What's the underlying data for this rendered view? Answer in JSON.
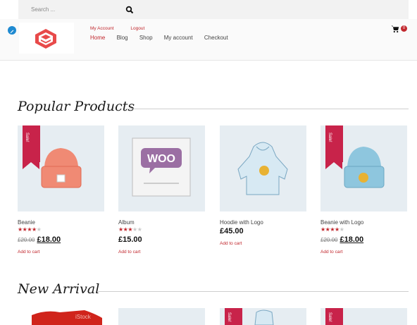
{
  "search": {
    "placeholder": "Search ..."
  },
  "header": {
    "account_links": [
      "My Account",
      "Logout"
    ],
    "nav": [
      "Home",
      "Blog",
      "Shop",
      "My account",
      "Checkout"
    ],
    "cart_count": "0"
  },
  "sections": {
    "popular": "Popular Products",
    "new_arrival": "New Arrival"
  },
  "products": [
    {
      "name": "Beanie",
      "rating": 4,
      "old_price": "£20.00",
      "price": "£18.00",
      "sale": "Sale!",
      "add_to_cart": "Add to cart",
      "color": "#f08a74"
    },
    {
      "name": "Album",
      "rating": 3,
      "old_price": "",
      "price": "£15.00",
      "sale": "",
      "add_to_cart": "Add to cart",
      "color": "#9b6fa3"
    },
    {
      "name": "Hoodie with Logo",
      "rating": 0,
      "old_price": "",
      "price": "£45.00",
      "sale": "",
      "add_to_cart": "Add to cart",
      "color": "#a9cfe6"
    },
    {
      "name": "Beanie with Logo",
      "rating": 4,
      "old_price": "£20.00",
      "price": "£18.00",
      "sale": "Sale!",
      "add_to_cart": "Add to cart",
      "color": "#8ec6de"
    }
  ],
  "new_arrival_preview": [
    {
      "label": "iStock",
      "sale": ""
    },
    {
      "label": "",
      "sale": ""
    },
    {
      "label": "",
      "sale": "Sale!"
    },
    {
      "label": "",
      "sale": "Sale!"
    }
  ],
  "colors": {
    "accent": "#c1272d",
    "sale": "#c8234a",
    "thumb_bg": "#e6edf2"
  }
}
